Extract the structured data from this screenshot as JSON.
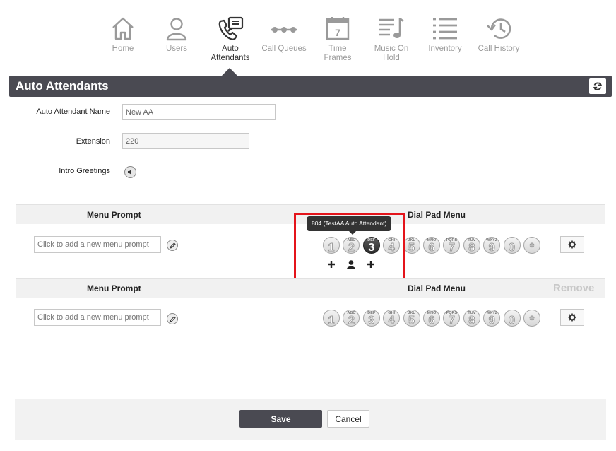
{
  "nav": {
    "items": [
      {
        "label": "Home",
        "icon": "home-icon"
      },
      {
        "label": "Users",
        "icon": "user-icon"
      },
      {
        "label": "Auto\nAttendants",
        "icon": "auto-attendant-icon"
      },
      {
        "label": "Call Queues",
        "icon": "call-queue-icon"
      },
      {
        "label": "Time\nFrames",
        "icon": "calendar-icon"
      },
      {
        "label": "Music On\nHold",
        "icon": "music-icon"
      },
      {
        "label": "Inventory",
        "icon": "list-icon"
      },
      {
        "label": "Call History",
        "icon": "history-icon"
      }
    ],
    "active": "Auto Attendants"
  },
  "section": {
    "title": "Auto Attendants",
    "refresh_icon": "refresh-icon"
  },
  "form": {
    "name_label": "Auto Attendant Name",
    "name_value": "New AA",
    "extension_label": "Extension",
    "extension_value": "220",
    "greetings_label": "Intro Greetings",
    "greetings_icon": "speaker-icon"
  },
  "menus": [
    {
      "prompt_header": "Menu Prompt",
      "dialpad_header": "Dial Pad Menu",
      "remove_label": "",
      "prompt_placeholder": "Click to add a new menu prompt",
      "selected_key": "3",
      "tooltip": "804 (TestAA Auto Attendant)"
    },
    {
      "prompt_header": "Menu Prompt",
      "dialpad_header": "Dial Pad Menu",
      "remove_label": "Remove",
      "prompt_placeholder": "Click to add a new menu prompt",
      "selected_key": "",
      "tooltip": ""
    }
  ],
  "keys": [
    {
      "num": "1",
      "sub": ""
    },
    {
      "num": "2",
      "sub": "ABC"
    },
    {
      "num": "3",
      "sub": "DEF"
    },
    {
      "num": "4",
      "sub": "GHI"
    },
    {
      "num": "5",
      "sub": "JKL"
    },
    {
      "num": "6",
      "sub": "MNO"
    },
    {
      "num": "7",
      "sub": "PQRS"
    },
    {
      "num": "8",
      "sub": "TUV"
    },
    {
      "num": "9",
      "sub": "WXYZ"
    },
    {
      "num": "0",
      "sub": ""
    },
    {
      "num": "*",
      "sub": ""
    }
  ],
  "footer": {
    "save_label": "Save",
    "cancel_label": "Cancel"
  },
  "colors": {
    "bar": "#4a4a52",
    "highlight": "#e4141b",
    "muted": "#9a9a9a"
  }
}
